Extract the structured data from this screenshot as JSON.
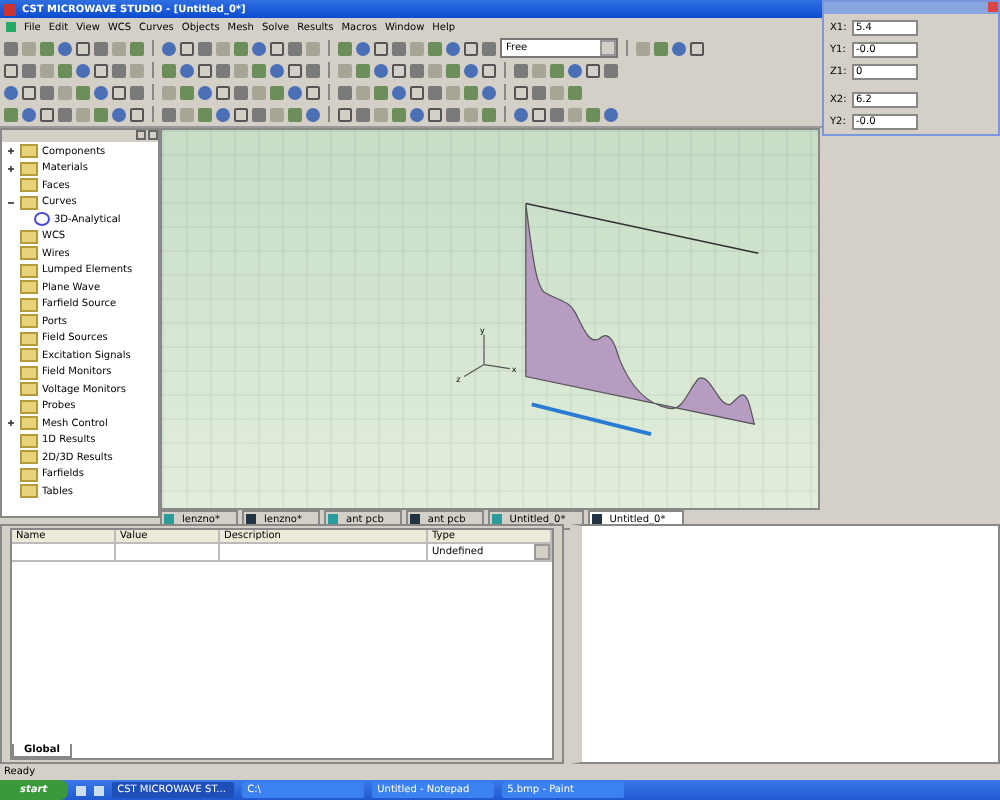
{
  "window": {
    "title": "CST MICROWAVE STUDIO - [Untitled_0*]"
  },
  "menu": [
    "File",
    "Edit",
    "View",
    "WCS",
    "Curves",
    "Objects",
    "Mesh",
    "Solve",
    "Results",
    "Macros",
    "Window",
    "Help"
  ],
  "toolbar": {
    "mode_dropdown": "Free"
  },
  "coordinate_dialog": {
    "fields": [
      {
        "label": "X1:",
        "value": "5.4"
      },
      {
        "label": "Y1:",
        "value": "-0.0"
      },
      {
        "label": "Z1:",
        "value": "0"
      },
      {
        "label": "X2:",
        "value": "6.2"
      },
      {
        "label": "Y2:",
        "value": "-0.0"
      }
    ]
  },
  "tree": {
    "items": [
      {
        "label": "Components",
        "expanded": false
      },
      {
        "label": "Materials",
        "expanded": false
      },
      {
        "label": "Faces"
      },
      {
        "label": "Curves",
        "expanded": true,
        "children": [
          {
            "label": "3D-Analytical"
          }
        ]
      },
      {
        "label": "WCS"
      },
      {
        "label": "Wires"
      },
      {
        "label": "Lumped Elements"
      },
      {
        "label": "Plane Wave"
      },
      {
        "label": "Farfield Source"
      },
      {
        "label": "Ports"
      },
      {
        "label": "Field Sources"
      },
      {
        "label": "Excitation Signals"
      },
      {
        "label": "Field Monitors"
      },
      {
        "label": "Voltage Monitors"
      },
      {
        "label": "Probes"
      },
      {
        "label": "Mesh Control",
        "expanded": false
      },
      {
        "label": "1D Results"
      },
      {
        "label": "2D/3D Results"
      },
      {
        "label": "Farfields"
      },
      {
        "label": "Tables"
      }
    ]
  },
  "viewport": {
    "axis_labels": [
      "y",
      "z",
      "x"
    ]
  },
  "document_tabs": [
    {
      "label": "lenzno*",
      "kind": "schematic",
      "selected": false
    },
    {
      "label": "lenzno*",
      "kind": "model",
      "selected": false
    },
    {
      "label": "ant pcb",
      "kind": "schematic",
      "selected": false
    },
    {
      "label": "ant pcb",
      "kind": "model",
      "selected": false
    },
    {
      "label": "Untitled_0*",
      "kind": "schematic",
      "selected": false
    },
    {
      "label": "Untitled_0*",
      "kind": "model",
      "selected": true
    }
  ],
  "parameters": {
    "columns": [
      "Name",
      "Value",
      "Description",
      "Type"
    ],
    "rows": [
      {
        "name": "",
        "value": "",
        "description": "",
        "type": "Undefined"
      }
    ],
    "sheet_tab": "Global"
  },
  "status_bar": "Ready",
  "taskbar": {
    "start": "start",
    "tasks": [
      {
        "label": "CST MICROWAVE ST...",
        "selected": true
      },
      {
        "label": "C:\\",
        "selected": false
      },
      {
        "label": "Untitled - Notepad",
        "selected": false
      },
      {
        "label": "5.bmp - Paint",
        "selected": false
      }
    ]
  }
}
